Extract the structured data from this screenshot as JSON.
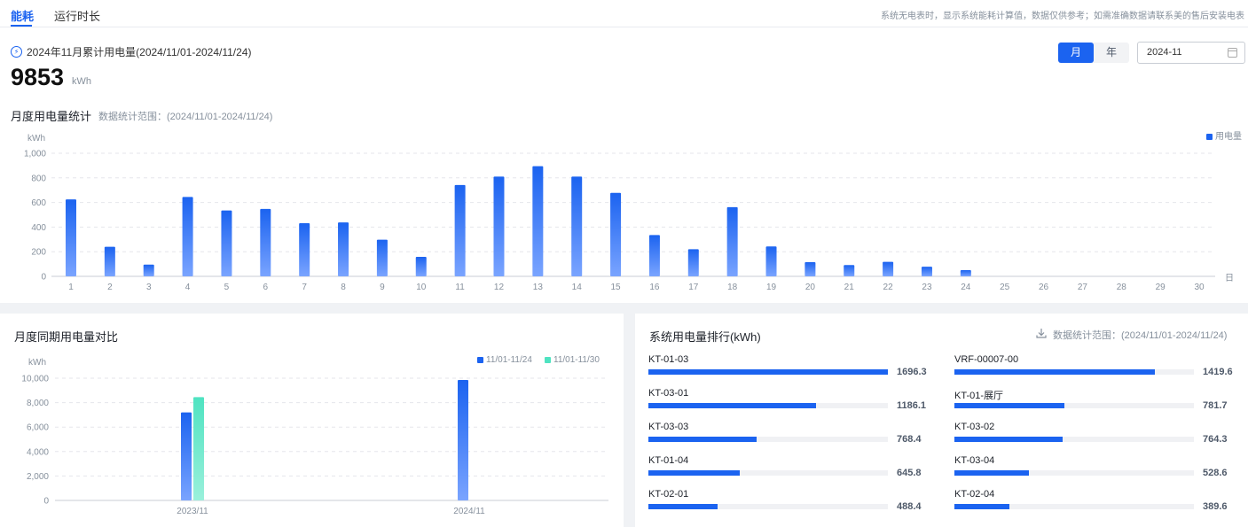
{
  "tabs": {
    "energy": "能耗",
    "runtime": "运行时长"
  },
  "note": "系统无电表时，显示系统能耗计算值，数据仅供参考；如需准确数据请联系美的售后安装电表",
  "summary": {
    "title": "2024年11月累计用电量(2024/11/01-2024/11/24)",
    "value": "9853",
    "unit": "kWh"
  },
  "period": {
    "month": "月",
    "year": "年",
    "date": "2024-11"
  },
  "monthly": {
    "title": "月度用电量统计",
    "range": "数据统计范围：(2024/11/01-2024/11/24)",
    "legend": "用电量",
    "unit_label": "kWh",
    "x_end_label": "日",
    "accent": "#1b63f0"
  },
  "compare": {
    "title": "月度同期用电量对比",
    "unit_label": "kWh",
    "colors": [
      "#1b63f0",
      "#4fe3c1"
    ]
  },
  "ranking": {
    "title": "系统用电量排行(kWh)",
    "range": "数据统计范围：(2024/11/01-2024/11/24)",
    "items": [
      {
        "name": "KT-01-03",
        "value": "1696.3",
        "pct": 100
      },
      {
        "name": "VRF-00007-00",
        "value": "1419.6",
        "pct": 83.7
      },
      {
        "name": "KT-03-01",
        "value": "1186.1",
        "pct": 69.9
      },
      {
        "name": "KT-01-展厅",
        "value": "781.7",
        "pct": 46.1
      },
      {
        "name": "KT-03-03",
        "value": "768.4",
        "pct": 45.3
      },
      {
        "name": "KT-03-02",
        "value": "764.3",
        "pct": 45.1
      },
      {
        "name": "KT-01-04",
        "value": "645.8",
        "pct": 38.1
      },
      {
        "name": "KT-03-04",
        "value": "528.6",
        "pct": 31.2
      },
      {
        "name": "KT-02-01",
        "value": "488.4",
        "pct": 28.8
      },
      {
        "name": "KT-02-04",
        "value": "389.6",
        "pct": 23.0
      }
    ]
  },
  "chart_data": [
    {
      "type": "bar",
      "title": "月度用电量统计",
      "xlabel": "日",
      "ylabel": "kWh",
      "ylim": [
        0,
        1000
      ],
      "yticks": [
        "0",
        "200",
        "400",
        "600",
        "800",
        "1,000"
      ],
      "categories": [
        "1",
        "2",
        "3",
        "4",
        "5",
        "6",
        "7",
        "8",
        "9",
        "10",
        "11",
        "12",
        "13",
        "14",
        "15",
        "16",
        "17",
        "18",
        "19",
        "20",
        "21",
        "22",
        "23",
        "24",
        "25",
        "26",
        "27",
        "28",
        "29",
        "30"
      ],
      "series": [
        {
          "name": "用电量",
          "values": [
            625,
            240,
            95,
            645,
            535,
            548,
            432,
            438,
            298,
            158,
            742,
            810,
            895,
            810,
            678,
            335,
            220,
            562,
            243,
            115,
            92,
            118,
            78,
            50,
            0,
            0,
            0,
            0,
            0,
            0
          ]
        }
      ]
    },
    {
      "type": "bar",
      "title": "月度同期用电量对比",
      "ylabel": "kWh",
      "ylim": [
        0,
        10000
      ],
      "yticks": [
        "0",
        "2,000",
        "4,000",
        "6,000",
        "8,000",
        "10,000"
      ],
      "categories": [
        "2023/11",
        "2024/11"
      ],
      "series": [
        {
          "name": "11/01-11/24",
          "values": [
            7200,
            9853
          ]
        },
        {
          "name": "11/01-11/30",
          "values": [
            8450,
            null
          ]
        }
      ]
    }
  ]
}
